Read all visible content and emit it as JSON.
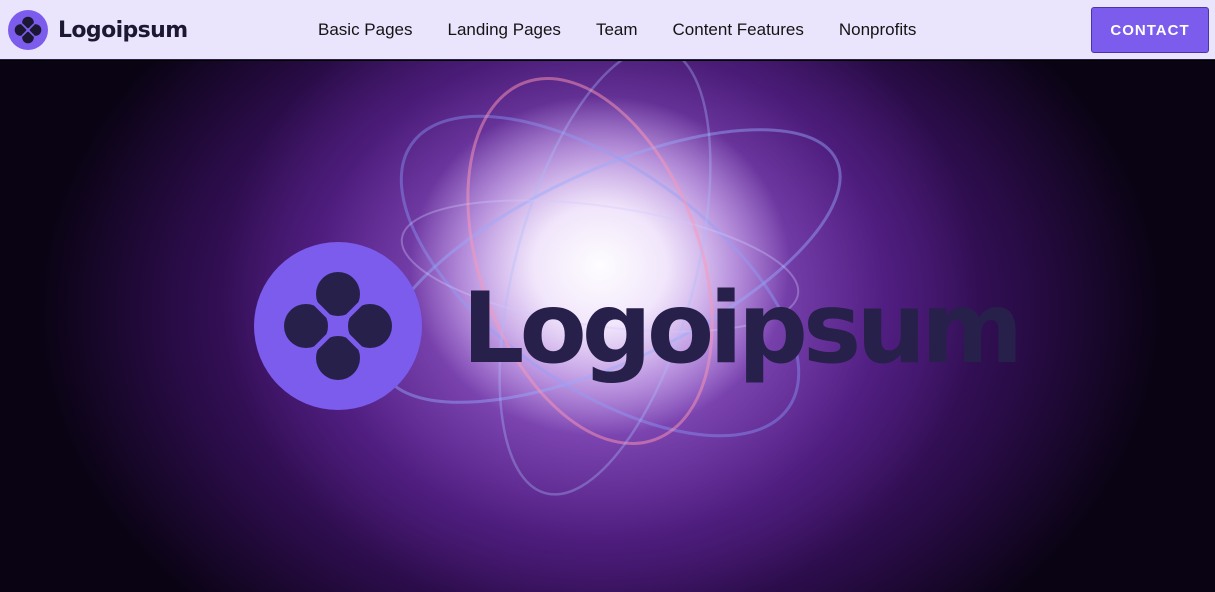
{
  "header": {
    "brand_name": "Logoipsum",
    "nav": [
      {
        "label": "Basic Pages"
      },
      {
        "label": "Landing Pages"
      },
      {
        "label": "Team"
      },
      {
        "label": "Content Features"
      },
      {
        "label": "Nonprofits"
      }
    ],
    "contact_label": "CONTACT"
  },
  "hero": {
    "logo_text": "Logoipsum"
  },
  "icons": {
    "brand_logo": "four-petal-circle-logo-icon"
  },
  "colors": {
    "nav_background": "#ebe4fd",
    "accent": "#7b5ced",
    "logo_text": "#27204a",
    "brand_text": "#1c1833"
  }
}
